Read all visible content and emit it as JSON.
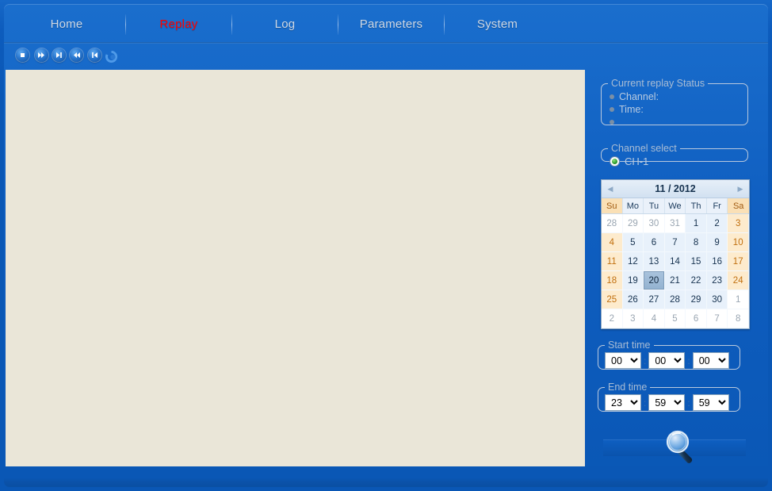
{
  "nav": {
    "items": [
      {
        "id": "home",
        "label": "Home",
        "active": false
      },
      {
        "id": "replay",
        "label": "Replay",
        "active": true
      },
      {
        "id": "log",
        "label": "Log",
        "active": false
      },
      {
        "id": "params",
        "label": "Parameters",
        "active": false
      },
      {
        "id": "system",
        "label": "System",
        "active": false
      }
    ],
    "active_color": "#ff0000",
    "inactive_color": "#cfd9e6"
  },
  "toolbar": {
    "buttons": [
      {
        "id": "stop",
        "icon": "stop-icon"
      },
      {
        "id": "fast-forward",
        "icon": "fast-forward-icon"
      },
      {
        "id": "next-frame",
        "icon": "skip-next-icon"
      },
      {
        "id": "rewind",
        "icon": "rewind-icon"
      },
      {
        "id": "prev-frame",
        "icon": "skip-previous-icon"
      },
      {
        "id": "loop",
        "icon": "loop-icon"
      }
    ],
    "seek": {
      "value_percent": 0,
      "track_color": "#b3c6dd",
      "handle_color": "#eda133"
    }
  },
  "video": {
    "background_color": "#eae6d8"
  },
  "sidebar": {
    "status_panel": {
      "legend": "Current replay Status",
      "items": [
        "Channel:",
        "Time:",
        ""
      ]
    },
    "channel_panel": {
      "legend": "Channel select",
      "options": [
        {
          "label": "CH-1",
          "selected": true
        }
      ]
    },
    "calendar": {
      "title": "11 / 2012",
      "prev_label": "◀",
      "next_label": "▶",
      "weekdays": [
        {
          "label": "Su",
          "weekend": true
        },
        {
          "label": "Mo",
          "weekend": false
        },
        {
          "label": "Tu",
          "weekend": false
        },
        {
          "label": "We",
          "weekend": false
        },
        {
          "label": "Th",
          "weekend": false
        },
        {
          "label": "Fr",
          "weekend": false
        },
        {
          "label": "Sa",
          "weekend": true
        }
      ],
      "selected_day": 20,
      "days": [
        {
          "d": 28,
          "other": true,
          "we": true
        },
        {
          "d": 29,
          "other": true,
          "we": false
        },
        {
          "d": 30,
          "other": true,
          "we": false
        },
        {
          "d": 31,
          "other": true,
          "we": false
        },
        {
          "d": 1,
          "other": false,
          "we": false
        },
        {
          "d": 2,
          "other": false,
          "we": false
        },
        {
          "d": 3,
          "other": false,
          "we": true
        },
        {
          "d": 4,
          "other": false,
          "we": true
        },
        {
          "d": 5,
          "other": false,
          "we": false
        },
        {
          "d": 6,
          "other": false,
          "we": false
        },
        {
          "d": 7,
          "other": false,
          "we": false
        },
        {
          "d": 8,
          "other": false,
          "we": false
        },
        {
          "d": 9,
          "other": false,
          "we": false
        },
        {
          "d": 10,
          "other": false,
          "we": true
        },
        {
          "d": 11,
          "other": false,
          "we": true
        },
        {
          "d": 12,
          "other": false,
          "we": false
        },
        {
          "d": 13,
          "other": false,
          "we": false
        },
        {
          "d": 14,
          "other": false,
          "we": false
        },
        {
          "d": 15,
          "other": false,
          "we": false
        },
        {
          "d": 16,
          "other": false,
          "we": false
        },
        {
          "d": 17,
          "other": false,
          "we": true
        },
        {
          "d": 18,
          "other": false,
          "we": true
        },
        {
          "d": 19,
          "other": false,
          "we": false
        },
        {
          "d": 20,
          "other": false,
          "we": false
        },
        {
          "d": 21,
          "other": false,
          "we": false
        },
        {
          "d": 22,
          "other": false,
          "we": false
        },
        {
          "d": 23,
          "other": false,
          "we": false
        },
        {
          "d": 24,
          "other": false,
          "we": true
        },
        {
          "d": 25,
          "other": false,
          "we": true
        },
        {
          "d": 26,
          "other": false,
          "we": false
        },
        {
          "d": 27,
          "other": false,
          "we": false
        },
        {
          "d": 28,
          "other": false,
          "we": false
        },
        {
          "d": 29,
          "other": false,
          "we": false
        },
        {
          "d": 30,
          "other": false,
          "we": false
        },
        {
          "d": 1,
          "other": true,
          "we": true
        },
        {
          "d": 2,
          "other": true,
          "we": true
        },
        {
          "d": 3,
          "other": true,
          "we": false
        },
        {
          "d": 4,
          "other": true,
          "we": false
        },
        {
          "d": 5,
          "other": true,
          "we": false
        },
        {
          "d": 6,
          "other": true,
          "we": false
        },
        {
          "d": 7,
          "other": true,
          "we": false
        },
        {
          "d": 8,
          "other": true,
          "we": true
        }
      ]
    },
    "start_time": {
      "legend": "Start time",
      "hour": "00",
      "minute": "00",
      "second": "00",
      "separator": ":"
    },
    "end_time": {
      "legend": "End time",
      "hour": "23",
      "minute": "59",
      "second": "59",
      "separator": ":"
    },
    "search_button": {
      "icon": "magnifier-icon",
      "label": ""
    }
  },
  "theme": {
    "window_blue": "#0a57b5",
    "panel_border": "#b9c9de",
    "legend_text": "#a8bcd4",
    "calendar_weekend_bg": "#fdebcd",
    "calendar_selected_bg": "#a9c3dd"
  }
}
